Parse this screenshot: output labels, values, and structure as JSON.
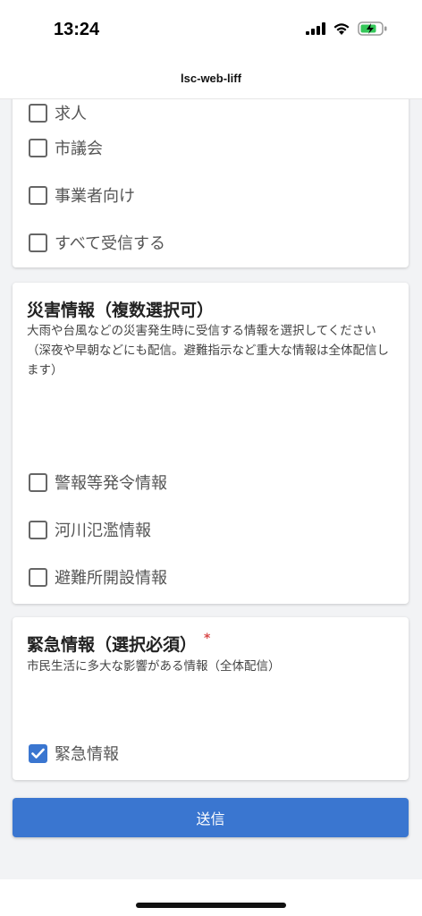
{
  "status_bar": {
    "time": "13:24"
  },
  "nav": {
    "title": "lsc-web-liff"
  },
  "top_card": {
    "items": [
      {
        "label": "求人",
        "checked": false
      },
      {
        "label": "市議会",
        "checked": false
      },
      {
        "label": "事業者向け",
        "checked": false
      },
      {
        "label": "すべて受信する",
        "checked": false
      }
    ]
  },
  "disaster_card": {
    "title": "災害情報（複数選択可）",
    "description": "大雨や台風などの災害発生時に受信する情報を選択してください\n（深夜や早朝などにも配信。避難指示など重大な情報は全体配信します）",
    "items": [
      {
        "label": "警報等発令情報",
        "checked": false
      },
      {
        "label": "河川氾濫情報",
        "checked": false
      },
      {
        "label": "避難所開設情報",
        "checked": false
      }
    ]
  },
  "emergency_card": {
    "title": "緊急情報（選択必須）",
    "required_mark": "*",
    "description": "市民生活に多大な影響がある情報（全体配信）",
    "items": [
      {
        "label": "緊急情報",
        "checked": true
      }
    ]
  },
  "submit": {
    "label": "送信"
  },
  "colors": {
    "accent": "#3a76d0",
    "required": "#d94a4a"
  }
}
